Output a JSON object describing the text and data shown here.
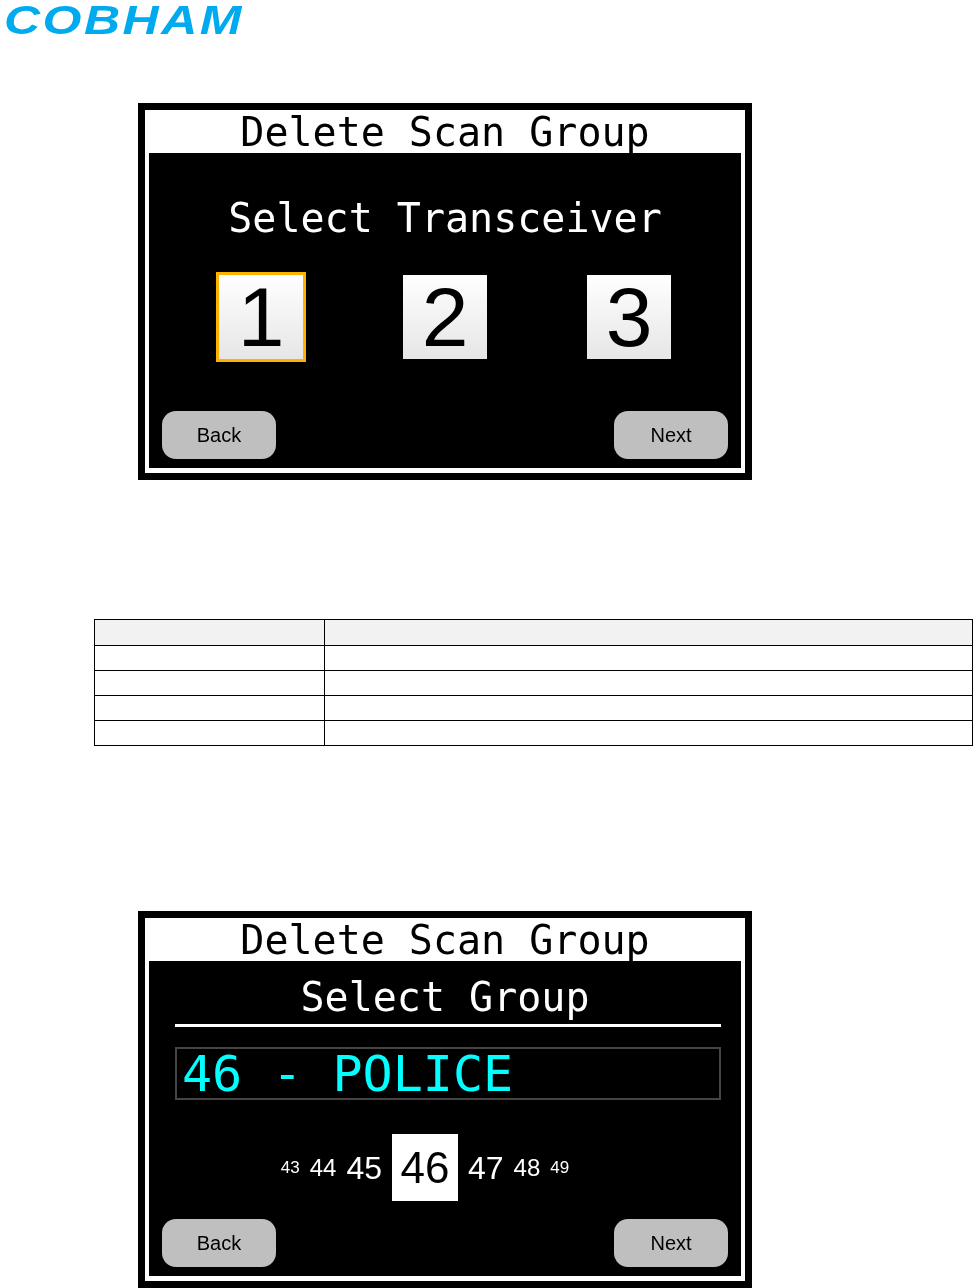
{
  "logo": {
    "text": "COBHAM"
  },
  "screens": [
    {
      "kind": "transceiver",
      "title": "Delete Scan Group",
      "heading": "Select Transceiver",
      "options": [
        {
          "label": "1",
          "selected": true
        },
        {
          "label": "2",
          "selected": false
        },
        {
          "label": "3",
          "selected": false
        }
      ],
      "buttons": [
        "Back",
        "Next"
      ]
    },
    {
      "kind": "group",
      "title": "Delete Scan Group",
      "heading": "Select Group",
      "value": "46 - POLICE",
      "numbers": [
        {
          "label": "43",
          "selected": false
        },
        {
          "label": "44",
          "selected": false
        },
        {
          "label": "45",
          "selected": false
        },
        {
          "label": "46",
          "selected": true
        },
        {
          "label": "47",
          "selected": false
        },
        {
          "label": "48",
          "selected": false
        },
        {
          "label": "49",
          "selected": false
        }
      ],
      "buttons": [
        "Back",
        "Next"
      ]
    }
  ],
  "table": {
    "rows": [
      {
        "kind": "header"
      },
      {
        "kind": "body"
      },
      {
        "kind": "body"
      },
      {
        "kind": "body"
      },
      {
        "kind": "body"
      }
    ]
  }
}
